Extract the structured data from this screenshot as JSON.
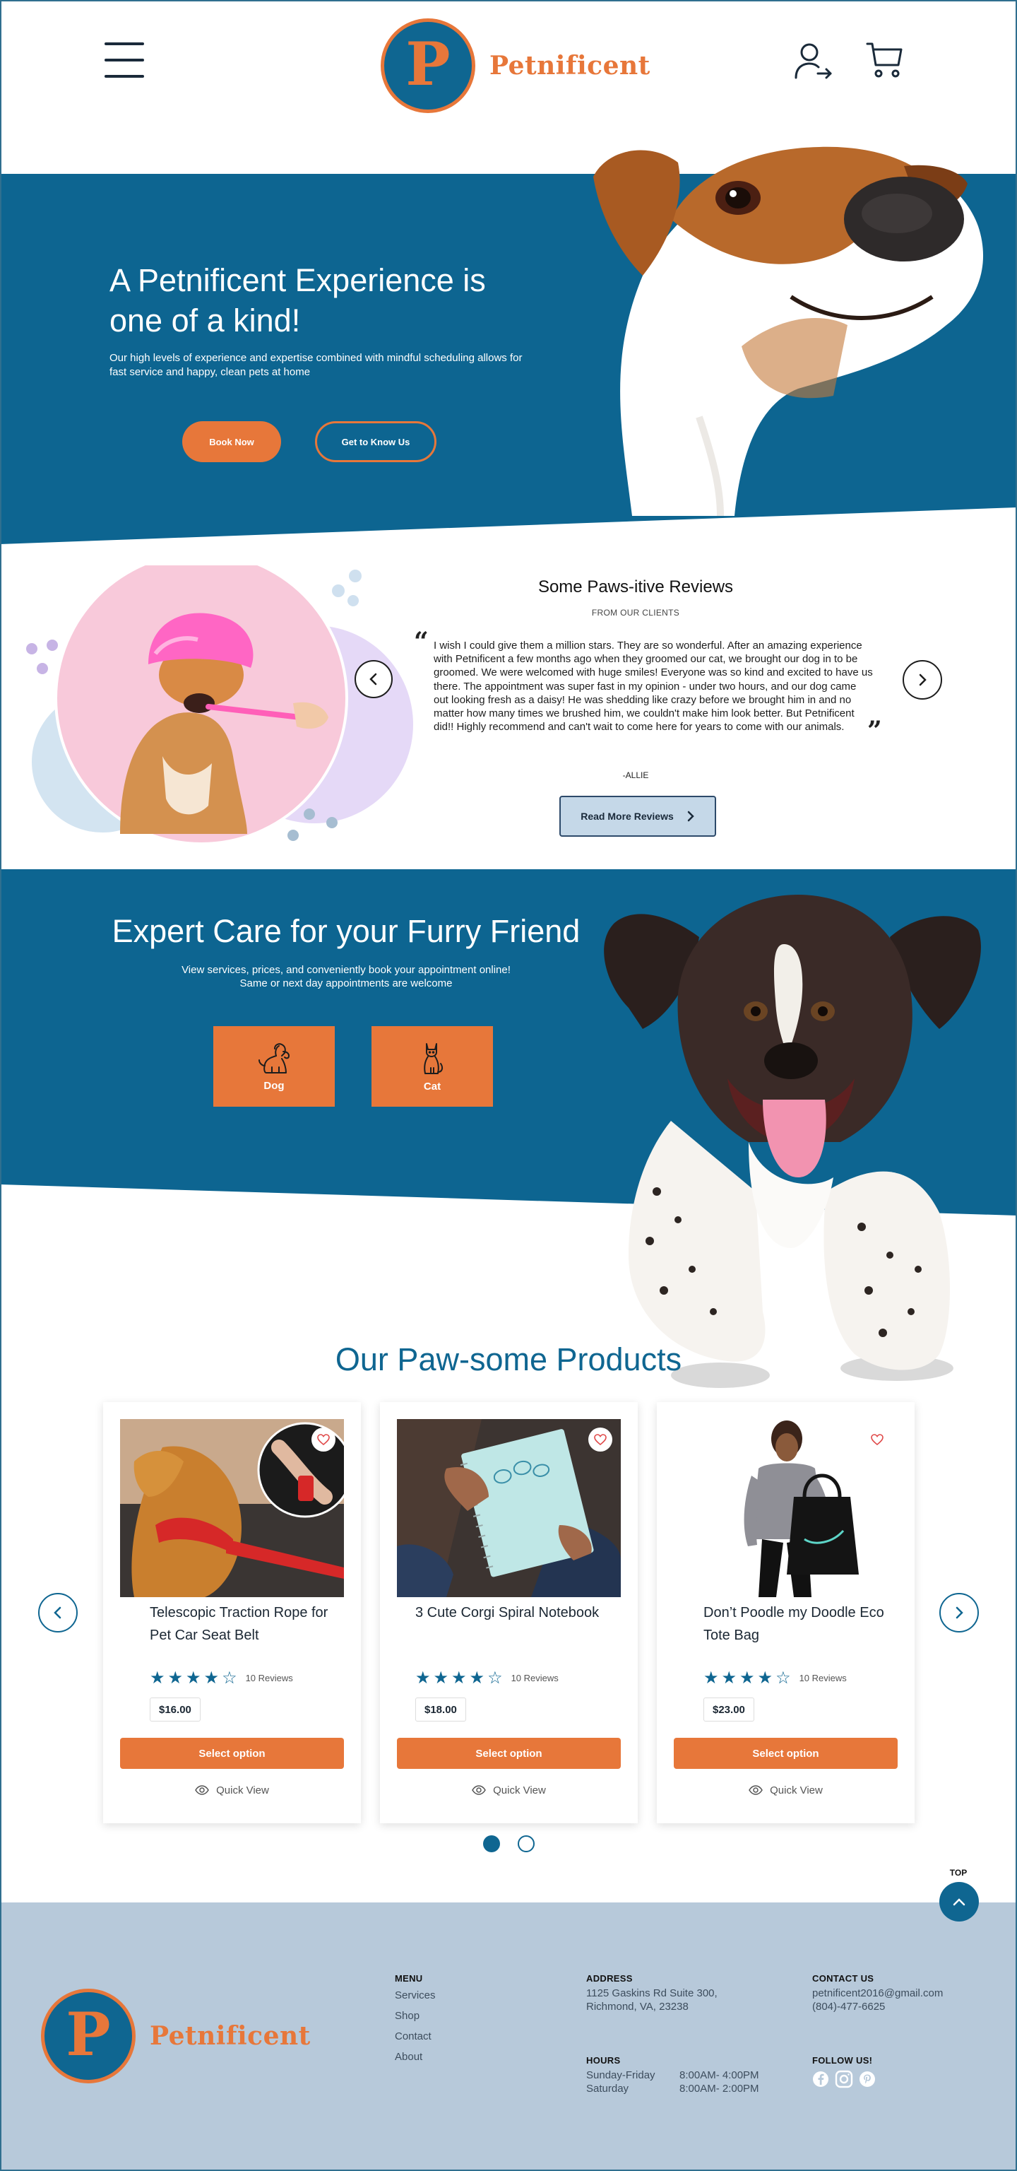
{
  "header": {
    "brand_letter": "P",
    "brand_name": "Petnificent"
  },
  "hero": {
    "title": "A Petnificent Experience is one of a kind!",
    "subtitle": "Our high levels of experience and expertise combined with mindful scheduling allows for fast service and happy, clean pets at home",
    "book_label": "Book Now",
    "know_label": "Get to Know Us"
  },
  "reviews": {
    "title": "Some Paws-itive Reviews",
    "subtitle": "FROM OUR CLIENTS",
    "open_quote": "“",
    "close_quote": "”",
    "body": "I wish I could give them a million stars. They are so wonderful. After an amazing experience with Petnificent a few months ago when they groomed our cat, we brought our dog in to be groomed. We were welcomed with huge smiles! Everyone was so kind and excited to have us there. The appointment was super fast in my opinion - under two hours, and our dog came out looking fresh as a daisy! He was shedding like crazy before we brought him in and no matter how many times we brushed him, we couldn't make him look better. But Petnificent did!! Highly recommend and can't wait to come here for years to come with our animals.",
    "author": "-ALLIE",
    "read_more_label": "Read More Reviews"
  },
  "expert": {
    "title": "Expert Care for your Furry Friend",
    "subtitle_line1": "View services, prices, and conveniently book your appointment online!",
    "subtitle_line2": "Same or next day appointments are welcome",
    "dog_label": "Dog",
    "cat_label": "Cat"
  },
  "products": {
    "title": "Our Paw-some Products",
    "items": [
      {
        "name": "Telescopic Traction Rope for Pet Car Seat Belt",
        "rating": 4,
        "reviews": "10 Reviews",
        "price": "$16.00",
        "select_label": "Select option",
        "quickview_label": "Quick View"
      },
      {
        "name": "3 Cute Corgi Spiral Notebook",
        "rating": 4,
        "reviews": "10 Reviews",
        "price": "$18.00",
        "select_label": "Select option",
        "quickview_label": "Quick View"
      },
      {
        "name": "Don’t Poodle my Doodle Eco Tote Bag",
        "rating": 4,
        "reviews": "10 Reviews",
        "price": "$23.00",
        "select_label": "Select option",
        "quickview_label": "Quick View"
      }
    ],
    "page_count": 2,
    "active_page": 1,
    "top_label": "TOP"
  },
  "footer": {
    "brand_letter": "P",
    "brand_name": "Petnificent",
    "menu_heading": "MENU",
    "menu_items": [
      "Services",
      "Shop",
      "Contact",
      "About"
    ],
    "address_heading": "ADDRESS",
    "address_line1": "1125 Gaskins Rd Suite 300,",
    "address_line2": "Richmond, VA, 23238",
    "hours_heading": "HOURS",
    "hours": [
      {
        "day": "Sunday-Friday",
        "time": "8:00AM- 4:00PM"
      },
      {
        "day": "Saturday",
        "time": "8:00AM- 2:00PM"
      }
    ],
    "contact_heading": "CONTACT US",
    "email": "petnificent2016@gmail.com",
    "phone": "(804)-477-6625",
    "follow_heading": "FOLLOW US!",
    "social": [
      "facebook-icon",
      "instagram-icon",
      "pinterest-icon"
    ]
  },
  "colors": {
    "brand_blue": "#0d6591",
    "brand_orange": "#e7773a",
    "footer_bg": "#b7c9da",
    "review_button_bg": "#c5d8e8"
  }
}
